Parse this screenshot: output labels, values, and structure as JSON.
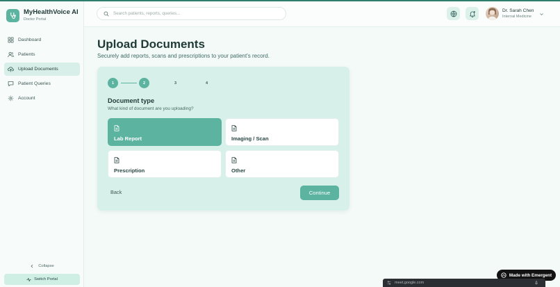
{
  "app": {
    "name": "MyHealthVoice AI",
    "subtitle": "Doctor Portal"
  },
  "sidebar": {
    "items": [
      {
        "label": "Dashboard",
        "icon": "dashboard-icon",
        "active": false
      },
      {
        "label": "Patients",
        "icon": "users-icon",
        "active": false
      },
      {
        "label": "Upload Documents",
        "icon": "cloud-upload-icon",
        "active": true
      },
      {
        "label": "Patient Queries",
        "icon": "message-icon",
        "active": false
      },
      {
        "label": "Account",
        "icon": "gear-icon",
        "active": false
      }
    ],
    "collapse_label": "Collapse",
    "switch_portal_label": "Switch Portal"
  },
  "header": {
    "search_placeholder": "Search patients, reports, queries...",
    "user": {
      "name": "Dr. Sarah Chen",
      "role": "Internal Medicine"
    }
  },
  "page": {
    "title": "Upload Documents",
    "subtitle": "Securely add reports, scans and prescriptions to your patient's record."
  },
  "wizard": {
    "steps": [
      {
        "label": "1",
        "status": "done"
      },
      {
        "label": "2",
        "status": "current"
      },
      {
        "label": "3",
        "status": "todo"
      },
      {
        "label": "4",
        "status": "todo"
      }
    ],
    "section_title": "Document type",
    "section_subtitle": "What kind of document are you uploading?",
    "options": [
      {
        "label": "Lab Report",
        "selected": true
      },
      {
        "label": "Imaging / Scan",
        "selected": false
      },
      {
        "label": "Prescription",
        "selected": false
      },
      {
        "label": "Other",
        "selected": false
      }
    ],
    "back_label": "Back",
    "continue_label": "Continue"
  },
  "overlays": {
    "badge_label": "Made with Emergent",
    "meet_url": "meet.google.com"
  },
  "colors": {
    "accent": "#5bb3a0",
    "card_bg": "#d7f0ea",
    "page_bg": "#f4faf8",
    "text_primary": "#1f3a36"
  }
}
